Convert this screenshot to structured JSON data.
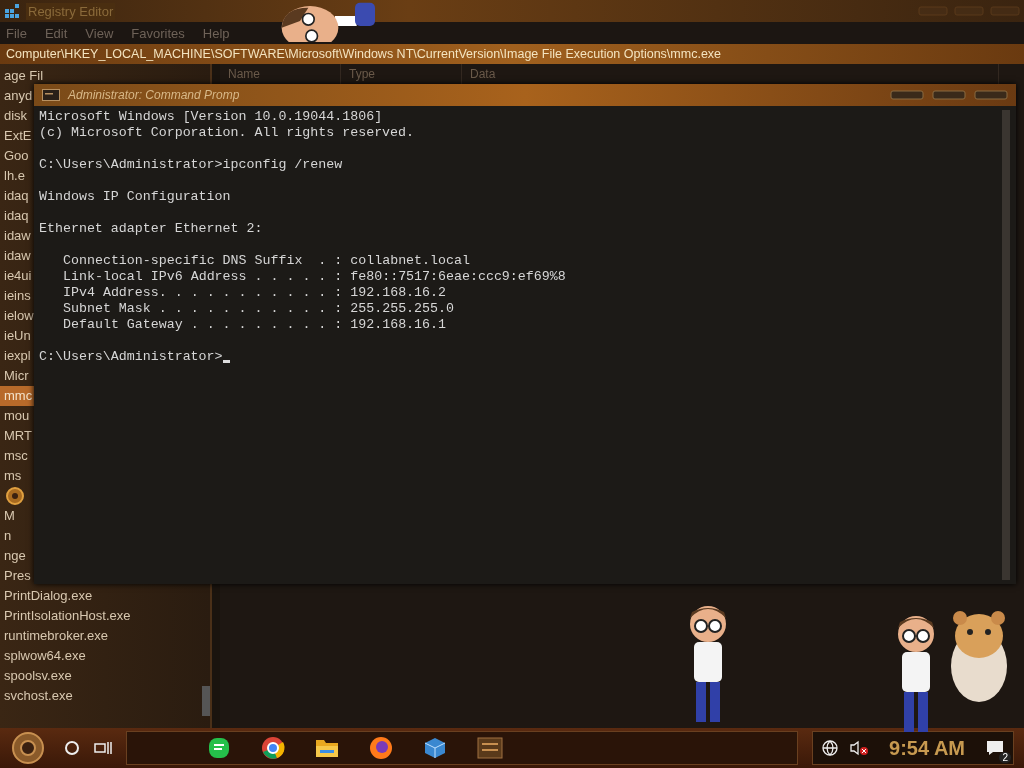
{
  "registry_editor": {
    "title": "Registry Editor",
    "menu": [
      "File",
      "Edit",
      "View",
      "Favorites",
      "Help"
    ],
    "address": "Computer\\HKEY_LOCAL_MACHINE\\SOFTWARE\\Microsoft\\Windows NT\\CurrentVersion\\Image File Execution Options\\mmc.exe",
    "keys": [
      {
        "label": "age Fil",
        "selected": false
      },
      {
        "label": "anyd",
        "selected": false
      },
      {
        "label": "disk",
        "selected": false
      },
      {
        "label": "ExtE",
        "selected": false
      },
      {
        "label": "Goo",
        "selected": false
      },
      {
        "label": "lh.e",
        "selected": false
      },
      {
        "label": "idaq",
        "selected": false
      },
      {
        "label": "idaq",
        "selected": false
      },
      {
        "label": "idaw",
        "selected": false
      },
      {
        "label": "idaw",
        "selected": false
      },
      {
        "label": "ie4ui",
        "selected": false
      },
      {
        "label": "ieins",
        "selected": false
      },
      {
        "label": "ielow",
        "selected": false
      },
      {
        "label": "ieUn",
        "selected": false
      },
      {
        "label": "iexpl",
        "selected": false
      },
      {
        "label": "Micr",
        "selected": false
      },
      {
        "label": "mmc",
        "selected": true
      },
      {
        "label": "mou",
        "selected": false
      },
      {
        "label": "MRT",
        "selected": false
      },
      {
        "label": "msc",
        "selected": false
      },
      {
        "label": "ms",
        "selected": false
      },
      {
        "kind": "ornament",
        "selected": false
      },
      {
        "label": "M",
        "selected": false
      },
      {
        "label": "n",
        "selected": false
      },
      {
        "label": "nge",
        "selected": false
      },
      {
        "label": "Pres",
        "selected": false
      },
      {
        "label": "PrintDialog.exe",
        "selected": false
      },
      {
        "label": "PrintIsolationHost.exe",
        "selected": false
      },
      {
        "label": "runtimebroker.exe",
        "selected": false
      },
      {
        "label": "splwow64.exe",
        "selected": false
      },
      {
        "label": "spoolsv.exe",
        "selected": false
      },
      {
        "label": "svchost.exe",
        "selected": false
      }
    ],
    "columns": [
      "Name",
      "Type",
      "Data"
    ]
  },
  "command_prompt": {
    "title": "Administrator: Command Promp",
    "blocks": [
      {
        "kind": "text",
        "lines": [
          "Microsoft Windows [Version 10.0.19044.1806]",
          "(c) Microsoft Corporation. All rights reserved."
        ]
      },
      {
        "kind": "text",
        "lines": [
          "C:\\Users\\Administrator>ipconfig /renew"
        ]
      },
      {
        "kind": "text",
        "lines": [
          "Windows IP Configuration"
        ]
      },
      {
        "kind": "section",
        "lines": [
          "Ethernet adapter Ethernet 2:"
        ]
      },
      {
        "kind": "details",
        "lines": [
          "Connection-specific DNS Suffix  . : collabnet.local",
          "Link-local IPv6 Address . . . . . : fe80::7517:6eae:ccc9:ef69%8",
          "IPv4 Address. . . . . . . . . . . : 192.168.16.2",
          "Subnet Mask . . . . . . . . . . . : 255.255.255.0",
          "Default Gateway . . . . . . . . . : 192.168.16.1"
        ]
      },
      {
        "kind": "prompt",
        "lines": [
          "C:\\Users\\Administrator>"
        ]
      }
    ]
  },
  "taskbar": {
    "clock": "9:54 AM",
    "notification_count": "2"
  }
}
